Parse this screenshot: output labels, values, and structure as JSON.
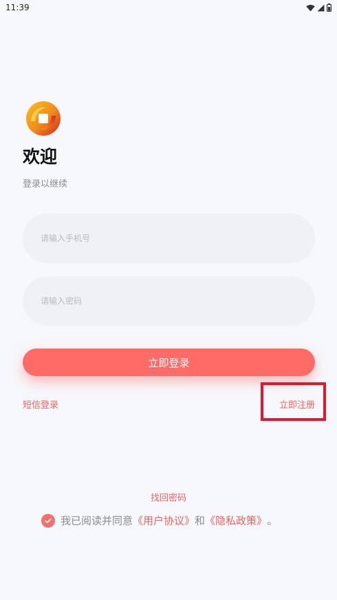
{
  "status_bar": {
    "time": "11:39"
  },
  "welcome": {
    "title": "欢迎",
    "subtitle": "登录以继续"
  },
  "form": {
    "phone_placeholder": "请输入手机号",
    "password_placeholder": "请输入密码",
    "login_label": "立即登录"
  },
  "links": {
    "sms_login": "短信登录",
    "register": "立即注册",
    "forgot_password": "找回密码"
  },
  "agreement": {
    "prefix": "我已阅读并同意",
    "user_agreement": "《用户协议》",
    "conjunction": "和",
    "privacy_policy": "《隐私政策》",
    "suffix": "。",
    "checked": true
  },
  "colors": {
    "accent": "#ff6b67",
    "link": "#f3625f",
    "highlight_box": "#e8142c",
    "background": "#f7f8fc"
  },
  "icons": [
    "wifi-icon",
    "cellular-signal-icon",
    "battery-icon",
    "app-logo",
    "checkmark-icon"
  ]
}
